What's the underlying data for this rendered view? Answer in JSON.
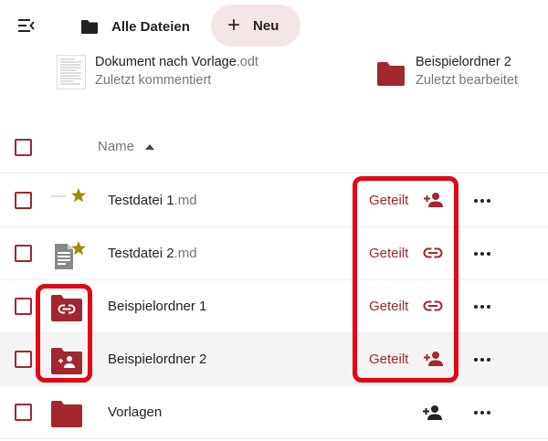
{
  "header": {
    "breadcrumb_label": "Alle Dateien",
    "new_label": "Neu",
    "new_symbol": "+"
  },
  "recent": [
    {
      "name": "Dokument nach Vorlage",
      "ext": ".odt",
      "subtitle": "Zuletzt kommentiert",
      "icon": "document-thumbnail-icon"
    },
    {
      "name": "Beispielordner 2",
      "ext": "",
      "subtitle": "Zuletzt bearbeitet",
      "icon": "folder-icon"
    }
  ],
  "list": {
    "column_name": "Name",
    "sort_direction": "ascending",
    "rows": [
      {
        "name": "Testdatei 1",
        "ext": ".md",
        "share_label": "Geteilt",
        "share_icon": "add-user-icon",
        "favorite": true,
        "icon": "file-loading-icon"
      },
      {
        "name": "Testdatei 2",
        "ext": ".md",
        "share_label": "Geteilt",
        "share_icon": "link-icon",
        "favorite": true,
        "icon": "text-file-icon"
      },
      {
        "name": "Beispielordner 1",
        "ext": "",
        "share_label": "Geteilt",
        "share_icon": "link-icon",
        "favorite": false,
        "icon": "folder-link-icon"
      },
      {
        "name": "Beispielordner 2",
        "ext": "",
        "share_label": "Geteilt",
        "share_icon": "add-user-icon",
        "favorite": false,
        "icon": "folder-shared-icon"
      },
      {
        "name": "Vorlagen",
        "ext": "",
        "share_label": "",
        "share_icon": "add-user-icon",
        "favorite": false,
        "icon": "folder-icon"
      }
    ]
  },
  "colors": {
    "accent": "#a2272f",
    "folder": "#a2272f",
    "favorite_star": "#a08a0a",
    "highlight": "#e30613",
    "new_button_bg": "#f4e6e6"
  }
}
